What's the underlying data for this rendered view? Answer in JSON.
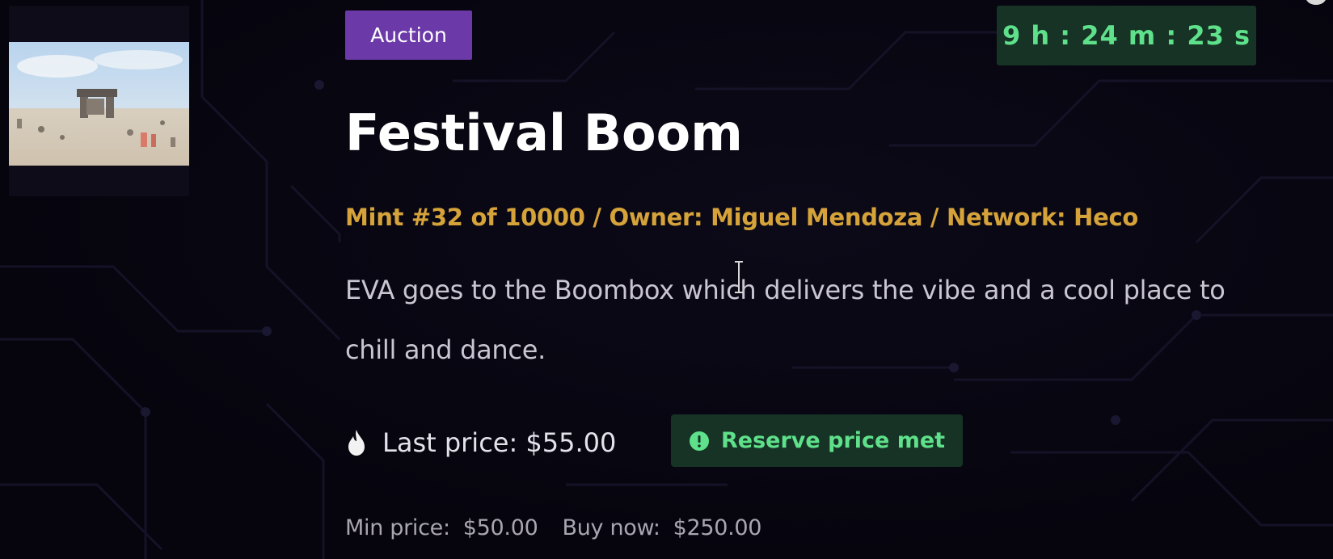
{
  "item": {
    "badge": "Auction",
    "countdown": "9 h : 24 m : 23 s",
    "title": "Festival Boom",
    "meta": "Mint #32 of 10000  / Owner: Miguel Mendoza  / Network: Heco",
    "description": "EVA goes to the Boombox which delivers the vibe and a cool place to chill and dance.",
    "last_price": "Last price: $55.00",
    "reserve_status": "Reserve price met",
    "min_price_label": "Min price:",
    "min_price_value": "$50.00",
    "buy_now_label": "Buy now:",
    "buy_now_value": "$250.00"
  },
  "colors": {
    "background": "#06040d",
    "badge": "#6b3aa8",
    "countdown_text": "#5fe08a",
    "meta_text": "#d6a33a"
  },
  "icons": {
    "price": "flame-icon",
    "reserve": "info-circle-icon"
  }
}
